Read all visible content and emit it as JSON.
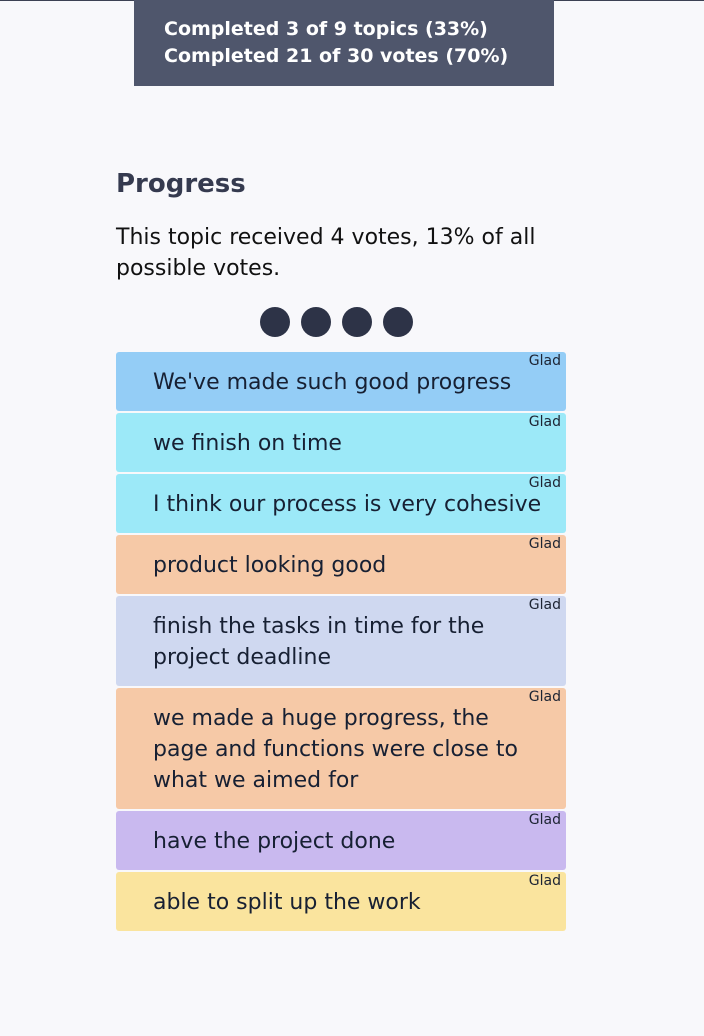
{
  "banner": {
    "topics_line": "Completed 3 of 9 topics (33%)",
    "votes_line": "Completed 21 of 30 votes (70%)"
  },
  "topic": {
    "title": "Progress",
    "summary": "This topic received 4 votes, 13% of all possible votes.",
    "vote_count": 4
  },
  "colors": {
    "banner_bg": "#4f566c",
    "vote_dot": "#2d3347",
    "blue": "#94cdf6",
    "cyan": "#9ce9f8",
    "peach": "#f6c9a7",
    "periwinkle": "#cfd8f0",
    "lavender": "#c9b9ef",
    "yellow": "#fae49e"
  },
  "cards": [
    {
      "text": "We've made such good progress",
      "tag": "Glad",
      "color": "#94cdf6"
    },
    {
      "text": "we finish on time",
      "tag": "Glad",
      "color": "#9ce9f8"
    },
    {
      "text": "I think our process is very cohesive",
      "tag": "Glad",
      "color": "#9ce9f8"
    },
    {
      "text": "product looking good",
      "tag": "Glad",
      "color": "#f6c9a7"
    },
    {
      "text": "finish the tasks in time for the project deadline",
      "tag": "Glad",
      "color": "#cfd8f0"
    },
    {
      "text": "we made a huge progress, the page and functions were close to what we aimed for",
      "tag": "Glad",
      "color": "#f6c9a7"
    },
    {
      "text": "have the project done",
      "tag": "Glad",
      "color": "#c9b9ef"
    },
    {
      "text": "able to split up the work",
      "tag": "Glad",
      "color": "#fae49e"
    }
  ]
}
